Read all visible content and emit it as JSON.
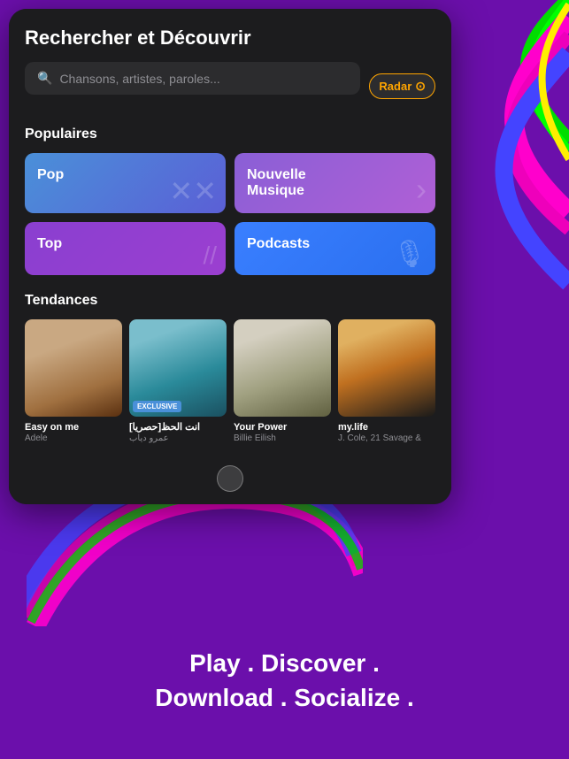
{
  "page": {
    "title": "Rechercher et Découvrir",
    "background_color": "#6B0FAB"
  },
  "search": {
    "placeholder": "Chansons, artistes, paroles...",
    "radar_label": "Radar"
  },
  "sections": {
    "popular_label": "Populaires",
    "trends_label": "Tendances"
  },
  "genre_cards": [
    {
      "id": "pop",
      "label": "Pop",
      "css_class": "card-pop",
      "icon": "✕"
    },
    {
      "id": "nouvelle-musique",
      "label": "Nouvelle\nMusique",
      "css_class": "card-nouvelle",
      "icon": "›"
    },
    {
      "id": "top",
      "label": "Top",
      "css_class": "card-top",
      "icon": "//"
    },
    {
      "id": "podcasts",
      "label": "Podcasts",
      "css_class": "card-podcasts",
      "icon": "🎙"
    }
  ],
  "trending": [
    {
      "id": "easy-on-me",
      "title": "Easy on me",
      "artist": "Adele",
      "exclusive": false,
      "art_class": "art-adele"
    },
    {
      "id": "anta-alhazz",
      "title": "انت الحظ[حصريا]",
      "artist": "عمرو دياب",
      "exclusive": true,
      "exclusive_label": "EXCLUSIVE",
      "art_class": "art-arabic"
    },
    {
      "id": "your-power",
      "title": "Your Power",
      "artist": "Billie Eilish",
      "exclusive": false,
      "art_class": "art-billie"
    },
    {
      "id": "my-life",
      "title": "my.life",
      "artist": "J. Cole, 21 Savage &",
      "exclusive": false,
      "art_class": "art-jcole"
    }
  ],
  "tagline": {
    "line1": "Play . Discover .",
    "line2": "Download . Socialize ."
  }
}
